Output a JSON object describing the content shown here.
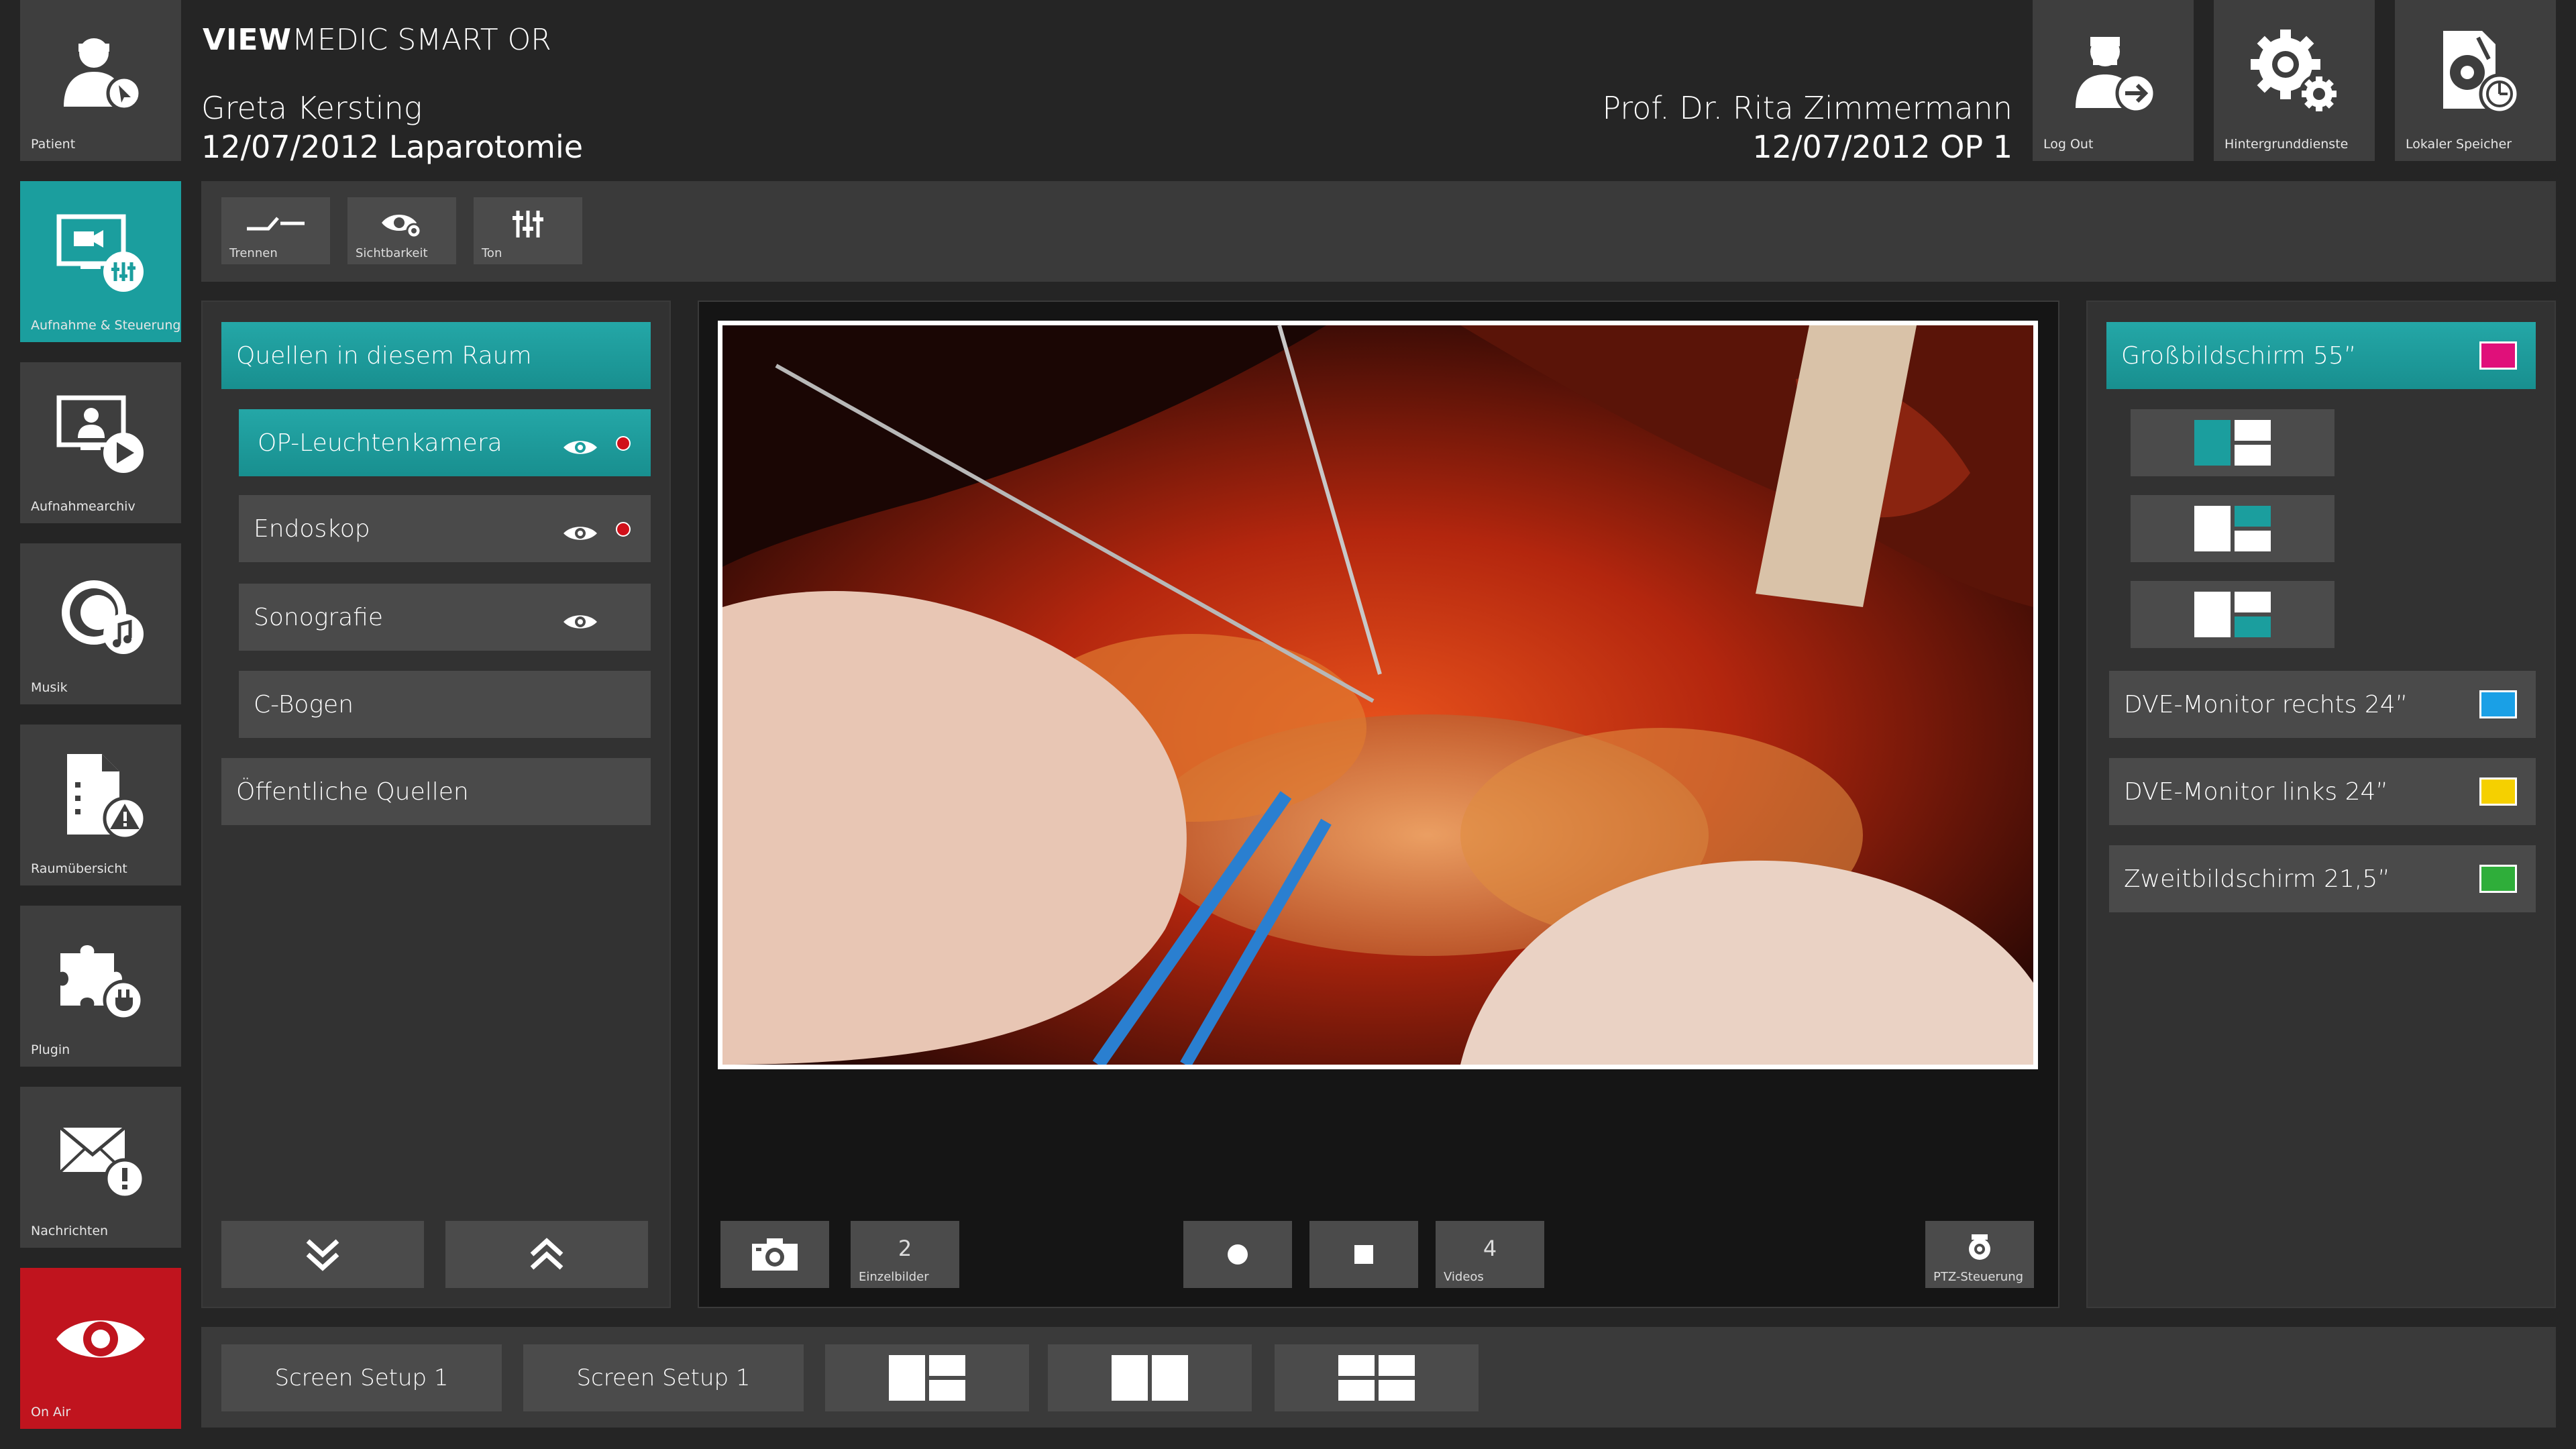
{
  "header": {
    "brand_bold": "VIEW",
    "brand_rest": "MEDIC SMART OR",
    "patient_name": "Greta Kersting",
    "patient_info": "12/07/2012 Laparotomie",
    "doctor_name": "Prof. Dr. Rita Zimmermann",
    "doctor_info": "12/07/2012 OP 1",
    "buttons": [
      {
        "label": "Log Out",
        "icon": "logout-icon"
      },
      {
        "label": "Hintergrunddienste",
        "icon": "gears-icon"
      },
      {
        "label": "Lokaler Speicher",
        "icon": "local-storage-icon"
      }
    ]
  },
  "sidebar": {
    "items": [
      {
        "label": "Patient",
        "icon": "patient-icon"
      },
      {
        "label": "Aufnahme & Steuerung",
        "icon": "recording-control-icon",
        "active": true
      },
      {
        "label": "Aufnahmearchiv",
        "icon": "archive-play-icon"
      },
      {
        "label": "Musik",
        "icon": "music-icon"
      },
      {
        "label": "Raumübersicht",
        "icon": "room-overview-icon"
      },
      {
        "label": "Plugin",
        "icon": "plugin-icon"
      },
      {
        "label": "Nachrichten",
        "icon": "messages-icon"
      },
      {
        "label": "On Air",
        "icon": "eye-icon"
      }
    ]
  },
  "toolbar": {
    "buttons": [
      {
        "label": "Trennen",
        "icon": "disconnect-icon"
      },
      {
        "label": "Sichtbarkeit",
        "icon": "visibility-icon"
      },
      {
        "label": "Ton",
        "icon": "sound-mixer-icon"
      }
    ]
  },
  "sources": {
    "room_header": "Quellen in diesem Raum",
    "items": [
      {
        "label": "OP-Leuchtenkamera",
        "visible": true,
        "live": true,
        "selected": true
      },
      {
        "label": "Endoskop",
        "visible": true,
        "live": true,
        "selected": false
      },
      {
        "label": "Sonografie",
        "visible": true,
        "live": false,
        "selected": false
      },
      {
        "label": "C-Bogen",
        "visible": false,
        "live": false,
        "selected": false
      }
    ],
    "public_header": "Öffentliche Quellen"
  },
  "video_controls": {
    "snapshot_count": "2",
    "snapshot_label": "Einzelbilder",
    "video_count": "4",
    "video_label": "Videos",
    "ptz_label": "PTZ-Steuerung"
  },
  "displays": {
    "items": [
      {
        "label": "Großbildschirm 55”",
        "color": "#e0107a",
        "selected": true
      },
      {
        "label": "DVE-Monitor rechts 24”",
        "color": "#1aa0e6",
        "selected": false
      },
      {
        "label": "DVE-Monitor links 24”",
        "color": "#f5d000",
        "selected": false
      },
      {
        "label": "Zweitbildschirm 21,5”",
        "color": "#2fae3a",
        "selected": false
      }
    ]
  },
  "bottom": {
    "setup1_label": "Screen Setup 1",
    "setup2_label": "Screen Setup 1"
  },
  "colors": {
    "accent": "#1b9e9e",
    "on_air": "#c0141e",
    "live_dot": "#d0101a"
  }
}
